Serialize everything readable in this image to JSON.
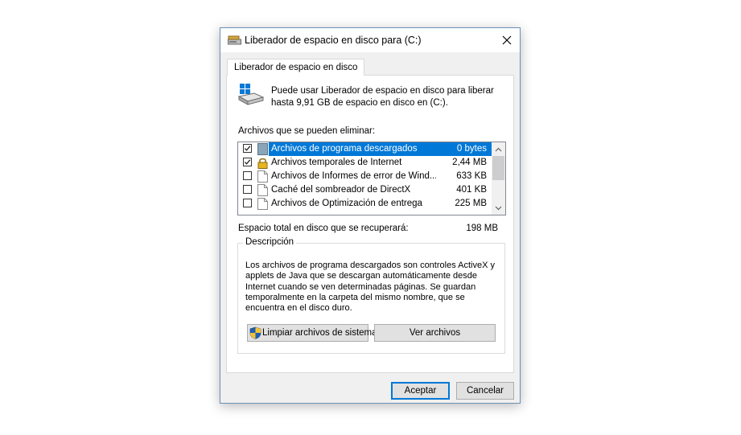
{
  "window": {
    "title": "Liberador de espacio en disco para  (C:)",
    "close_icon": "close-icon"
  },
  "tab": {
    "label": "Liberador de espacio en disco"
  },
  "intro": {
    "text": "Puede usar Liberador de espacio en disco para liberar hasta 9,91 GB de espacio en disco en  (C:)."
  },
  "files": {
    "label": "Archivos que se pueden eliminar:",
    "items": [
      {
        "name": "Archivos de programa descargados",
        "size": "0 bytes",
        "checked": true,
        "selected": true,
        "icon": "folder-icon"
      },
      {
        "name": "Archivos temporales de Internet",
        "size": "2,44 MB",
        "checked": true,
        "selected": false,
        "icon": "lock-icon"
      },
      {
        "name": "Archivos de Informes de error de Wind...",
        "size": "633 KB",
        "checked": false,
        "selected": false,
        "icon": "file-icon"
      },
      {
        "name": "Caché del sombreador de DirectX",
        "size": "401 KB",
        "checked": false,
        "selected": false,
        "icon": "file-icon"
      },
      {
        "name": "Archivos de Optimización de entrega",
        "size": "225 MB",
        "checked": false,
        "selected": false,
        "icon": "file-icon"
      }
    ]
  },
  "total": {
    "label": "Espacio total en disco que se recuperará:",
    "value": "198 MB"
  },
  "description": {
    "legend": "Descripción",
    "text": "Los archivos de programa descargados son controles ActiveX y applets de Java que se descargan automáticamente desde Internet cuando se ven determinadas páginas. Se guardan temporalmente en la carpeta del mismo nombre, que se encuentra en el disco duro."
  },
  "buttons": {
    "cleanup": "Limpiar archivos de sistema",
    "view": "Ver archivos",
    "ok": "Aceptar",
    "cancel": "Cancelar"
  },
  "colors": {
    "selection": "#0078d7",
    "border_accent": "#6b8fb6"
  }
}
